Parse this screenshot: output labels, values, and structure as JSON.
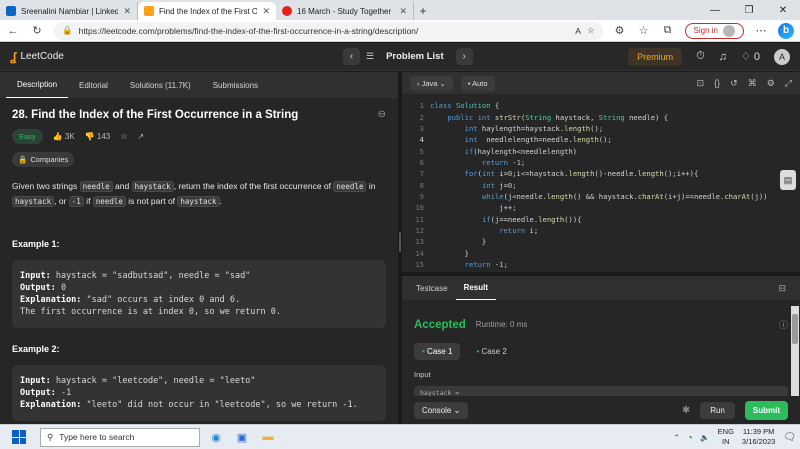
{
  "browser": {
    "tabs": [
      {
        "title": "Sreenalini Nambiar | LinkedIn",
        "icon": "linkedin-icon",
        "color": "#0a66c2"
      },
      {
        "title": "Find the Index of the First Occurre",
        "icon": "leetcode-icon",
        "color": "#ffa116"
      },
      {
        "title": "16 March - Study Together",
        "icon": "youtube-icon",
        "color": "#e62117"
      }
    ],
    "url": "https://leetcode.com/problems/find-the-index-of-the-first-occurrence-in-a-string/description/",
    "sign_in": "Sign in"
  },
  "lc_nav": {
    "logo": "LeetCode",
    "problem_list": "Problem List",
    "premium": "Premium",
    "streak": "0",
    "user_initial": "A"
  },
  "left_tabs": [
    "Description",
    "Editorial",
    "Solutions (11.7K)",
    "Submissions"
  ],
  "problem": {
    "title": "28. Find the Index of the First Occurrence in a String",
    "difficulty": "Easy",
    "likes": "3K",
    "dislikes": "143",
    "companies": "Companies",
    "desc_1": "Given two strings ",
    "desc_needle": "needle",
    "desc_2": " and ",
    "desc_haystack": "haystack",
    "desc_3": ", return the index of the first occurrence of ",
    "desc_4": " in",
    "desc_5": ", or ",
    "desc_minus1": "-1",
    "desc_6": " if ",
    "desc_7": " is not part of ",
    "desc_8": "."
  },
  "examples": [
    {
      "heading": "Example 1:",
      "input_label": "Input:",
      "input": " haystack = \"sadbutsad\", needle = \"sad\"",
      "output_label": "Output:",
      "output": " 0",
      "expl_label": "Explanation:",
      "expl": " \"sad\" occurs at index 0 and 6.",
      "expl2": "The first occurrence is at index 0, so we return 0."
    },
    {
      "heading": "Example 2:",
      "input_label": "Input:",
      "input": " haystack = \"leetcode\", needle = \"leeto\"",
      "output_label": "Output:",
      "output": " -1",
      "expl_label": "Explanation:",
      "expl": " \"leeto\" did not occur in \"leetcode\", so we return -1."
    }
  ],
  "editor": {
    "language": "Java",
    "mode": "Auto",
    "lines": [
      "class Solution {",
      "    public int strStr(String haystack, String needle) {",
      "        int haylength=haystack.length();",
      "        int  needlelength=needle.length();",
      "        if(haylength<needlelength)",
      "            return -1;",
      "        for(int i=0;i<=haystack.length()-needle.length();i++){",
      "            int j=0;",
      "            while(j<needle.length() && haystack.charAt(i+j)==needle.charAt(j))",
      "                j++;",
      "            if(j==needle.length()){",
      "                return i;",
      "            }",
      "        }",
      "        return -1;",
      "    }"
    ]
  },
  "console": {
    "tabs": [
      "Testcase",
      "Result"
    ],
    "status": "Accepted",
    "runtime": "Runtime: 0 ms",
    "cases": [
      "Case 1",
      "Case 2"
    ],
    "input_label": "Input",
    "input_preview": "haystack =",
    "console_btn": "Console",
    "run_btn": "Run",
    "submit_btn": "Submit"
  },
  "taskbar": {
    "search_placeholder": "Type here to search",
    "lang": "ENG",
    "region": "IN",
    "time": "11:39 PM",
    "date": "3/16/2023"
  }
}
